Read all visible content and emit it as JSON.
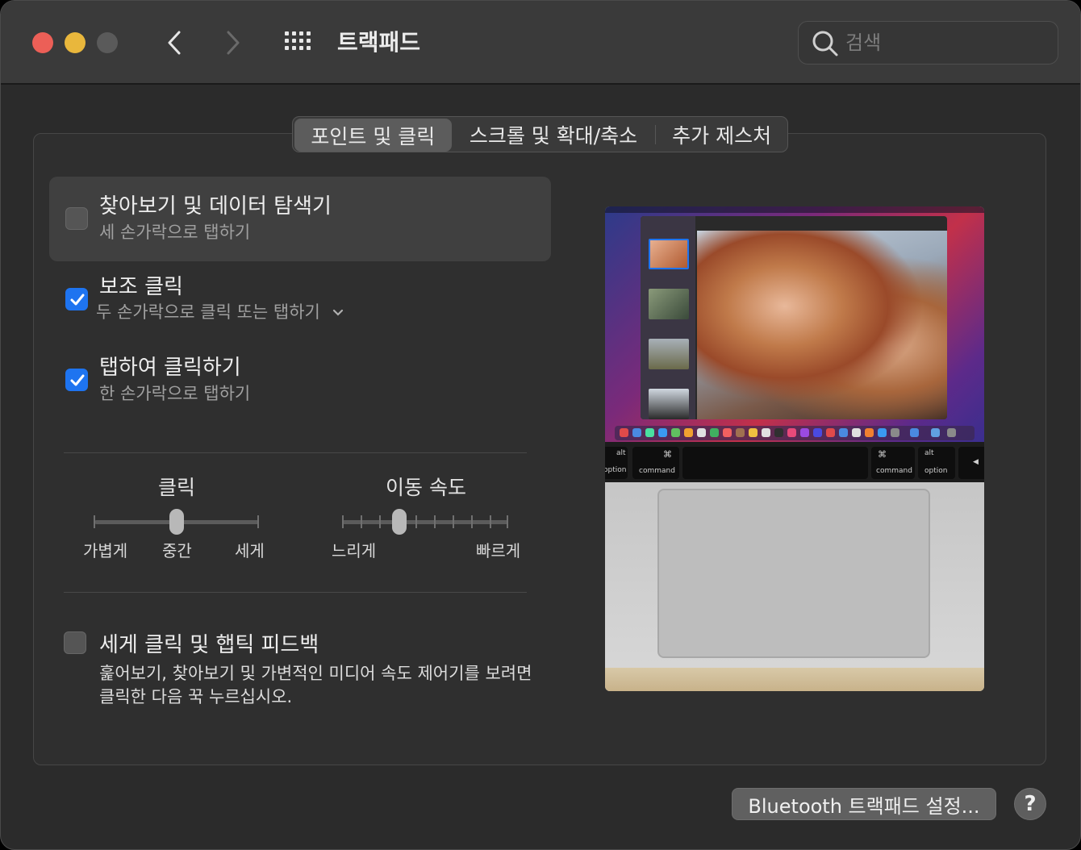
{
  "window": {
    "title": "트랙패드",
    "search_placeholder": "검색"
  },
  "tabs": [
    {
      "label": "포인트 및 클릭",
      "selected": true
    },
    {
      "label": "스크롤 및 확대/축소",
      "selected": false
    },
    {
      "label": "추가 제스처",
      "selected": false
    }
  ],
  "options": {
    "lookup": {
      "title": "찾아보기 및 데이터 탐색기",
      "subtitle": "세 손가락으로 탭하기",
      "checked": false
    },
    "secondary_click": {
      "title": "보조 클릭",
      "subtitle": "두 손가락으로 클릭 또는 탭하기",
      "checked": true
    },
    "tap_to_click": {
      "title": "탭하여 클릭하기",
      "subtitle": "한 손가락으로 탭하기",
      "checked": true
    },
    "force_click": {
      "title": "세게 클릭 및 햅틱 피드백",
      "description_line1": "훑어보기, 찾아보기 및 가변적인 미디어 속도 제어기를 보려면",
      "description_line2": "클릭한 다음 꾹 누르십시오.",
      "checked": false
    }
  },
  "sliders": {
    "click": {
      "label": "클릭",
      "min_label": "가볍게",
      "mid_label": "중간",
      "max_label": "세게",
      "positions": 3,
      "value_index": 1
    },
    "tracking_speed": {
      "label": "이동 속도",
      "min_label": "느리게",
      "max_label": "빠르게",
      "positions": 10,
      "value_index": 3
    }
  },
  "preview": {
    "keys": {
      "left_alt_top": "alt",
      "left_alt": "option",
      "left_cmd_symbol": "⌘",
      "left_cmd": "command",
      "right_cmd_symbol": "⌘",
      "right_cmd": "command",
      "right_alt_top": "alt",
      "right_alt": "option",
      "arrow": "◀"
    }
  },
  "buttons": {
    "bluetooth": "Bluetooth 트랙패드 설정...",
    "help": "?"
  },
  "colors": {
    "accent": "#1e74f0",
    "close": "#ec5f57",
    "minimize": "#e9b73c"
  }
}
